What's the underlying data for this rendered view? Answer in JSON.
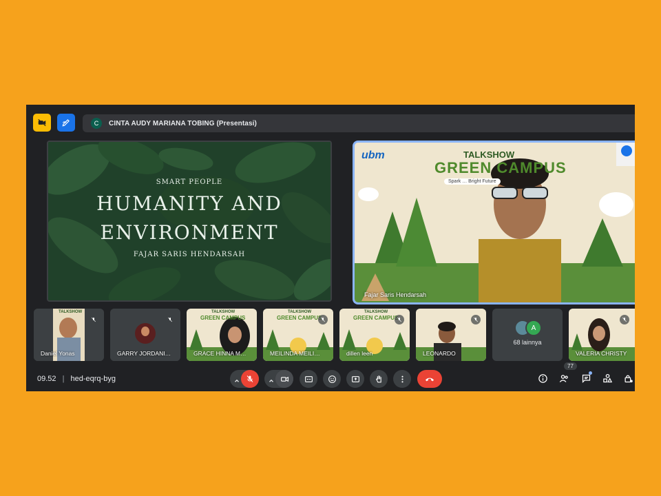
{
  "presenter_banner": {
    "avatar_letter": "C",
    "text": "CINTA AUDY MARIANA TOBING (Presentasi)"
  },
  "slide": {
    "subtitle": "SMART PEOPLE",
    "title_line1": "HUMANITY AND",
    "title_line2": "ENVIRONMENT",
    "author": "FAJAR SARIS HENDARSAH"
  },
  "spotlight": {
    "name": "Fajar Saris Hendarsah",
    "banner_brand": "ubm",
    "banner_small": "TALKSHOW",
    "banner_big": "GREEN CAMPUS",
    "banner_tagline": "Spark … Bright Future"
  },
  "participants": [
    {
      "name": "Daniel Yonas",
      "muted": true
    },
    {
      "name": "GARRY JORDANI…",
      "muted": true
    },
    {
      "name": "GRACE HINNA M…",
      "muted": false
    },
    {
      "name": "MEILINDA MEILI…",
      "muted": true
    },
    {
      "name": "dillen leen",
      "muted": true
    },
    {
      "name": "LEONARDO",
      "muted": true
    },
    {
      "name": "68 lainnya",
      "muted": false,
      "avatar_letter": "A"
    },
    {
      "name": "VALERIA CHRISTY",
      "muted": true
    }
  ],
  "thumb_banner": {
    "small": "TALKSHOW",
    "big": "GREEN CAMPUS"
  },
  "bottom": {
    "time": "09.52",
    "separator": "|",
    "meeting_code": "hed-eqrq-byg",
    "participant_count": "77"
  },
  "colors": {
    "orange_bg": "#f6a21c",
    "meet_dark": "#202124",
    "control_gray": "#3c4043",
    "red": "#ea4335",
    "blue_border": "#8ab4f8",
    "yellow_icon": "#fbbc04",
    "blue_icon": "#1a73e8"
  },
  "icons": [
    "camera-off-icon",
    "pen-icon",
    "mic-off-icon",
    "chevron-up-icon",
    "camera-icon",
    "captions-icon",
    "emoji-icon",
    "present-icon",
    "raise-hand-icon",
    "more-icon",
    "end-call-icon",
    "info-icon",
    "people-icon",
    "chat-icon",
    "activities-icon",
    "host-controls-icon"
  ]
}
